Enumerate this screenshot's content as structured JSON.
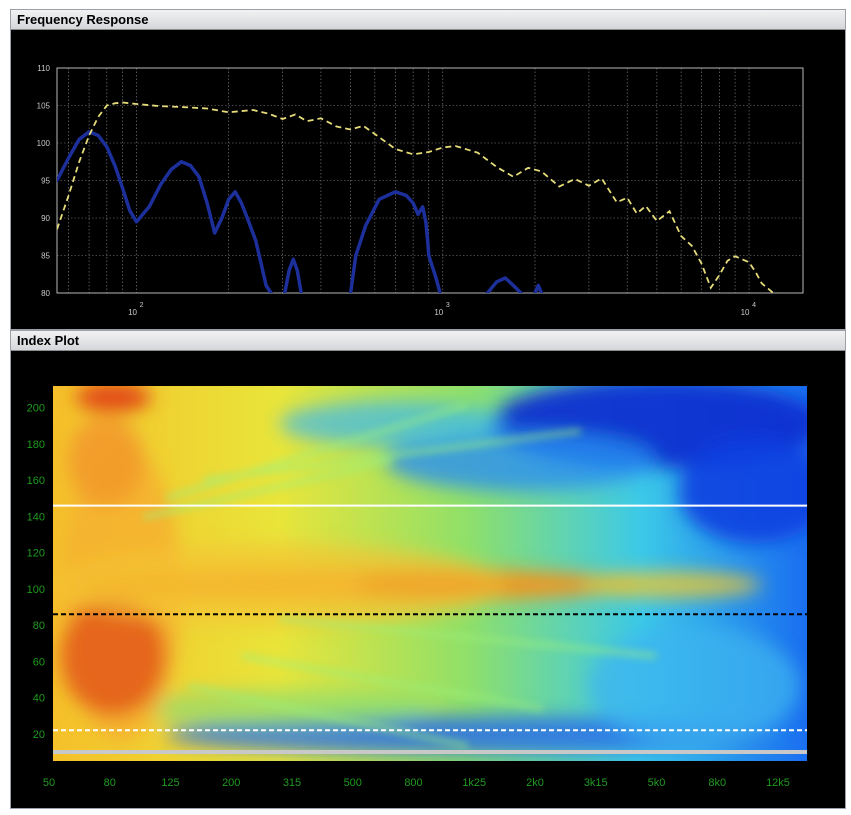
{
  "frequency_panel": {
    "title": "Frequency Response"
  },
  "index_panel": {
    "title": "Index Plot"
  },
  "colors": {
    "background": "#000000",
    "spl_curve": "#e6dc7a",
    "phase_curve": "#1c2f9a",
    "grid": "#8a8a8a",
    "tick_text_fr": "#c8c8c8",
    "tick_text_ip": "#1f9a1f",
    "hot": "#e2561a",
    "cold": "#0a2fd0",
    "marker_white": "#ffffff",
    "marker_black": "#000000",
    "marker_grey": "#c8c8c8"
  },
  "chart_data": [
    {
      "type": "line",
      "scale": "log-x",
      "xlim": [
        55,
        15000
      ],
      "ylim": [
        80,
        110
      ],
      "grid": true,
      "y_ticks": [
        "80",
        "85",
        "90",
        "95",
        "100",
        "105",
        "110"
      ],
      "x_ticks": [
        {
          "value": 100,
          "base": "10",
          "exp": "2"
        },
        {
          "value": 1000,
          "base": "10",
          "exp": "3"
        },
        {
          "value": 10000,
          "base": "10",
          "exp": "4"
        }
      ],
      "series": [
        {
          "style": "dashed",
          "color": "#e6dc7a",
          "x": [
            55,
            60,
            65,
            70,
            75,
            80,
            85,
            90,
            100,
            120,
            140,
            170,
            200,
            240,
            270,
            300,
            330,
            360,
            400,
            450,
            500,
            550,
            600,
            700,
            800,
            900,
            1000,
            1100,
            1300,
            1500,
            1700,
            1900,
            2100,
            2400,
            2700,
            3000,
            3300,
            3700,
            4000,
            4300,
            4600,
            5000,
            5500,
            6000,
            6500,
            7000,
            7500,
            8000,
            8500,
            9000,
            10000,
            10500,
            11000,
            12000,
            13000,
            14000,
            14500
          ],
          "y": [
            88.5,
            93,
            97.5,
            101,
            103.5,
            105,
            105.3,
            105.4,
            105.2,
            104.9,
            104.8,
            104.6,
            104.1,
            104.4,
            103.9,
            103.2,
            103.8,
            102.9,
            103.3,
            102.2,
            101.8,
            102.3,
            101.2,
            99.2,
            98.5,
            98.8,
            99.4,
            99.6,
            98.7,
            96.8,
            95.5,
            96.7,
            96.2,
            94.2,
            95.2,
            94.3,
            95.3,
            92.1,
            92.7,
            90.6,
            91.6,
            89.6,
            90.9,
            87.6,
            86.3,
            83.9,
            80.7,
            82.4,
            84.3,
            84.9,
            84.1,
            82.8,
            81.3,
            80.0,
            79.8,
            79.8,
            79.8
          ]
        },
        {
          "style": "solid",
          "color": "#1c2f9a",
          "segments": [
            {
              "x": [
                55,
                60,
                65,
                70,
                75,
                80,
                85,
                90,
                95,
                100,
                110,
                120,
                130,
                140,
                150,
                160,
                170,
                180,
                190,
                200,
                210,
                220,
                230,
                245,
                255,
                265,
                275
              ],
              "y": [
                95,
                98,
                100.5,
                101.5,
                101,
                99.5,
                97,
                94,
                91,
                89.5,
                91.5,
                94.5,
                96.5,
                97.5,
                97,
                95.5,
                92,
                88,
                90,
                92.5,
                93.5,
                92,
                90,
                87,
                84,
                81,
                80
              ]
            },
            {
              "x": [
                305,
                315,
                325,
                335,
                345
              ],
              "y": [
                80,
                83,
                84.5,
                83,
                80
              ]
            },
            {
              "x": [
                500,
                520,
                560,
                620,
                700,
                760,
                800,
                830,
                860,
                880,
                890,
                900,
                950,
                980
              ],
              "y": [
                80,
                85,
                89,
                92.5,
                93.5,
                93,
                92,
                90.5,
                91.5,
                89.5,
                87.5,
                85,
                82,
                80
              ]
            },
            {
              "x": [
                1400,
                1500,
                1600,
                1700,
                1800
              ],
              "y": [
                80,
                81.5,
                82,
                81,
                80
              ]
            },
            {
              "x": [
                2000,
                2050,
                2100
              ],
              "y": [
                80,
                81,
                80
              ]
            }
          ]
        }
      ]
    },
    {
      "type": "heatmap",
      "x_tick_labels": [
        "50",
        "80",
        "125",
        "200",
        "315",
        "500",
        "800",
        "1k25",
        "2k0",
        "3k15",
        "5k0",
        "8k0",
        "12k5"
      ],
      "y_ticks": [
        "20",
        "40",
        "60",
        "80",
        "100",
        "120",
        "140",
        "160",
        "180",
        "200"
      ],
      "ylim": [
        5,
        212
      ],
      "colormap": "jet",
      "hotspots": [
        {
          "x": "50–200",
          "y": [
            20,
            100
          ],
          "level": "high"
        },
        {
          "x": "80–10k",
          "y": [
            95,
            120
          ],
          "level": "high"
        },
        {
          "x": "80",
          "y": [
            200,
            212
          ],
          "level": "high"
        },
        {
          "x": "2k0–12k5",
          "y": [
            150,
            212
          ],
          "level": "low"
        }
      ],
      "horizontal_lines": [
        {
          "y": 146,
          "style": "solid",
          "color": "#ffffff"
        },
        {
          "y": 86,
          "style": "dashed",
          "color": "#000000"
        },
        {
          "y": 22,
          "style": "dashed",
          "color": "#ffffff"
        },
        {
          "y": 10,
          "style": "solid",
          "color": "#c8c8c8"
        }
      ]
    }
  ]
}
